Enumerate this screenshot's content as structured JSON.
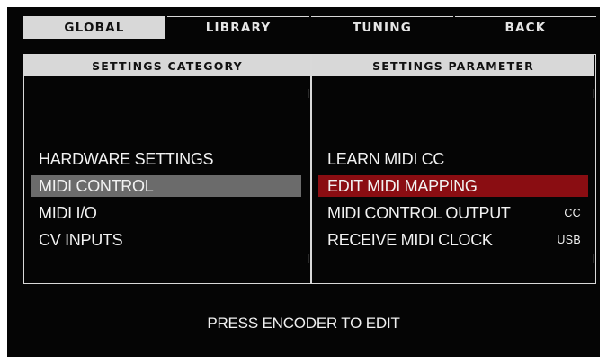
{
  "tabs": [
    {
      "label": "GLOBAL",
      "active": true
    },
    {
      "label": "LIBRARY",
      "active": false
    },
    {
      "label": "TUNING",
      "active": false
    },
    {
      "label": "BACK",
      "active": false
    }
  ],
  "left": {
    "header": "SETTINGS CATEGORY",
    "items": [
      {
        "label": "HARDWARE SETTINGS"
      },
      {
        "label": "MIDI CONTROL",
        "selected": true
      },
      {
        "label": "MIDI I/O"
      },
      {
        "label": "CV INPUTS"
      }
    ]
  },
  "right": {
    "header": "SETTINGS PARAMETER",
    "items": [
      {
        "label": "LEARN MIDI CC",
        "value": ""
      },
      {
        "label": "EDIT MIDI MAPPING",
        "value": "",
        "selected": true
      },
      {
        "label": "MIDI CONTROL OUTPUT",
        "value": "CC"
      },
      {
        "label": "RECEIVE MIDI CLOCK",
        "value": "USB"
      }
    ]
  },
  "footer": {
    "hint": "PRESS ENCODER TO EDIT"
  },
  "colors": {
    "selected_category": "#6b6b6b",
    "selected_parameter": "#8a0d12",
    "background": "#050505",
    "header": "#d8d8d8"
  }
}
